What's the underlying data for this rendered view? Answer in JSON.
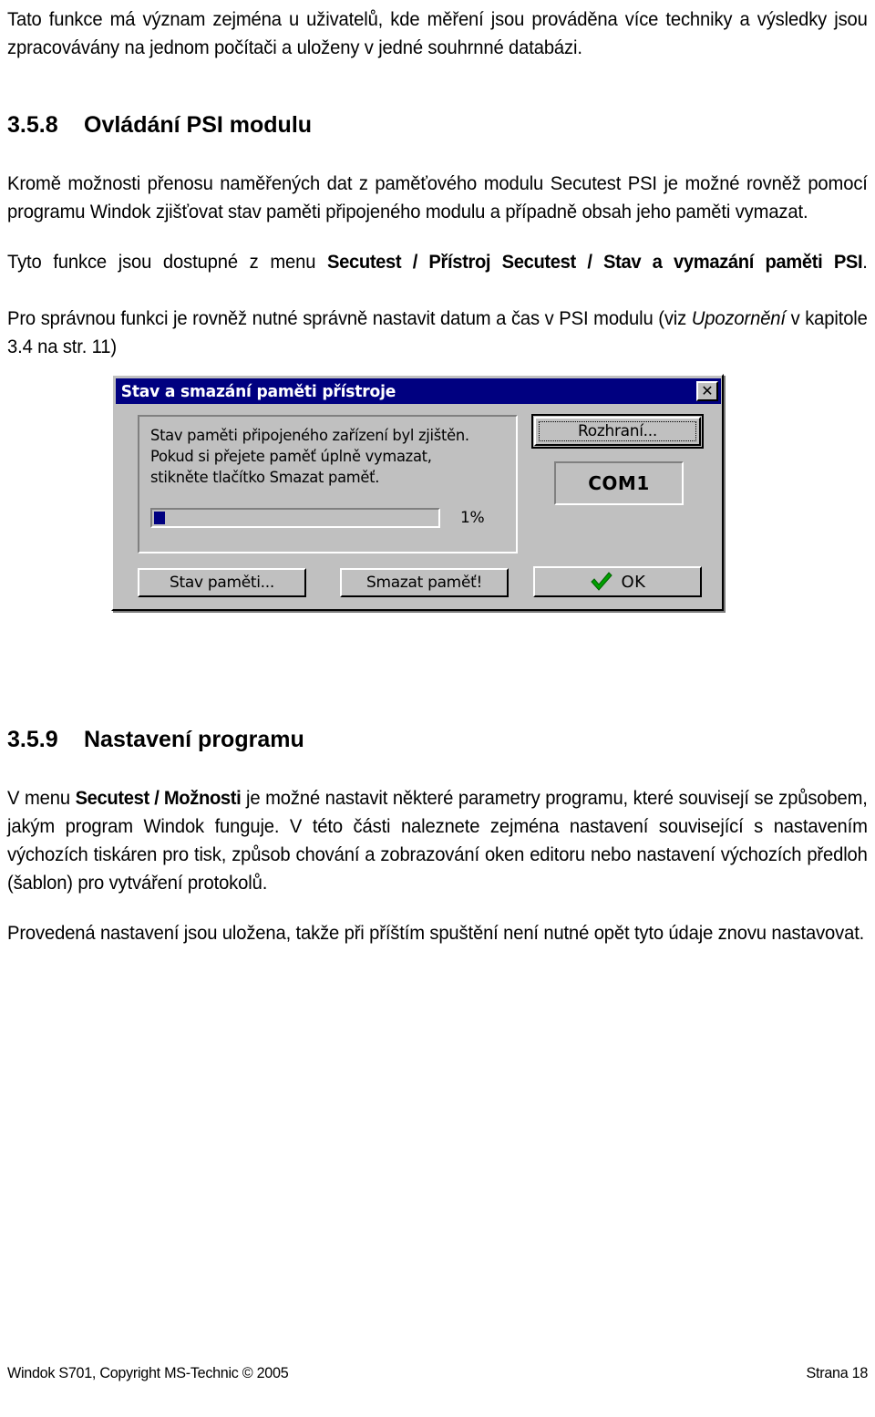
{
  "document": {
    "intro_paragraph": "Tato funkce má význam zejména u uživatelů, kde měření jsou prováděna více techniky a výsledky jsou zpracovávány na jednom počítači a uloženy v jedné souhrnné databázi.",
    "section_358": {
      "number": "3.5.8",
      "title": "Ovládání PSI modulu",
      "paragraph_1": "Kromě možnosti přenosu naměřených dat z paměťového modulu Secutest PSI je možné rovněž pomocí programu Windok zjišťovat stav paměti připojeného modulu a případně obsah jeho paměti vymazat.",
      "paragraph_2_prefix": "Tyto funkce jsou dostupné z menu ",
      "paragraph_2_menu": "Secutest / Přístroj Secutest / Stav a vymazání paměti PSI",
      "paragraph_2_suffix": ".",
      "paragraph_3_prefix": "Pro správnou funkci je rovněž nutné správně nastavit datum a čas v PSI modulu (viz ",
      "paragraph_3_italic": "Upozornění",
      "paragraph_3_suffix": " v kapitole 3.4 na str. 11)"
    },
    "section_359": {
      "number": "3.5.9",
      "title": "Nastavení programu",
      "paragraph_1_prefix": "V menu ",
      "paragraph_1_menu": "Secutest / Možnosti",
      "paragraph_1_suffix": " je možné nastavit některé parametry programu, které souvisejí se způsobem, jakým program Windok funguje. V této části naleznete zejména nastavení související s nastavením výchozích tiskáren pro tisk, způsob chování a zobrazování oken editoru nebo nastavení výchozích předloh (šablon) pro vytváření protokolů.",
      "paragraph_2": "Provedená nastavení jsou uložena, takže při příštím spuštění není nutné opět tyto údaje znovu nastavovat."
    }
  },
  "dialog": {
    "title": "Stav a smazání paměti přístroje",
    "close_label": "✕",
    "message": "Stav paměti připojeného zařízení byl zjištěn. Pokud si přejete paměť úplně vymazat, stikněte tlačítko Smazat paměť.",
    "progress": {
      "value": 1,
      "label": "1%",
      "fill_percent": 4
    },
    "buttons": {
      "memory_status": "Stav paměti...",
      "erase_memory": "Smazat paměť!",
      "interface": "Rozhraní...",
      "ok": "OK"
    },
    "port_value": "COM1",
    "colors": {
      "titlebar": "#000080",
      "face": "#c0c0c0",
      "progress_fill": "#000080",
      "check_green": "#00a000"
    }
  },
  "footer": {
    "left": "Windok S701, Copyright MS-Technic © 2005",
    "right": "Strana 18"
  }
}
